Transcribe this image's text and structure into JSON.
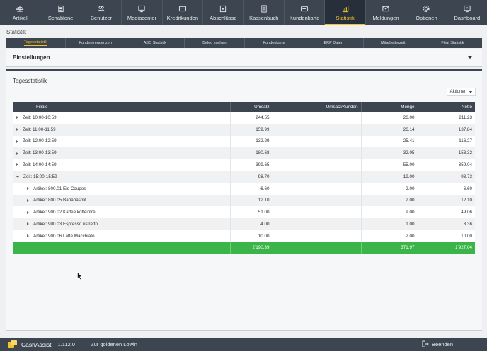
{
  "nav": [
    {
      "label": "Artikel",
      "icon": "scale-icon"
    },
    {
      "label": "Schablone",
      "icon": "template-icon"
    },
    {
      "label": "Benutzer",
      "icon": "users-icon"
    },
    {
      "label": "Mediacenter",
      "icon": "monitor-icon"
    },
    {
      "label": "Kreditkunden",
      "icon": "credit-card-icon"
    },
    {
      "label": "Abschlüsse",
      "icon": "closing-icon"
    },
    {
      "label": "Kassenbuch",
      "icon": "book-icon"
    },
    {
      "label": "Kundenkarte",
      "icon": "card-icon"
    },
    {
      "label": "Statistik",
      "icon": "chart-icon",
      "active": true
    },
    {
      "label": "Meldungen",
      "icon": "mail-icon"
    },
    {
      "label": "Optionen",
      "icon": "gear-icon"
    },
    {
      "label": "Dashboard",
      "icon": "dashboard-icon"
    }
  ],
  "page_title": "Statistik",
  "subtabs": [
    "Tagesstatistik",
    "Kundenfrequenzen",
    "ABC Statistik",
    "Beleg suchen",
    "Kundenkarte",
    "ERP Daten",
    "Mitarbeiterzeit",
    "Filial Statistik"
  ],
  "settings_title": "Einstellungen",
  "main_title": "Tagesstatistik",
  "actions_label": "Aktionen",
  "table": {
    "headers": [
      "Filiale",
      "Umsatz",
      "Umsatz/Kunden",
      "Menge",
      "Netto"
    ],
    "rows": [
      {
        "level": 0,
        "open": false,
        "name": "Zeit: 10:00-10:59",
        "umsatz": "244.55",
        "uk": "",
        "menge": "26.00",
        "netto": "211.23"
      },
      {
        "level": 0,
        "open": false,
        "name": "Zeit: 11:00-11:59",
        "umsatz": "159.99",
        "uk": "",
        "menge": "26.14",
        "netto": "137.84"
      },
      {
        "level": 0,
        "open": false,
        "name": "Zeit: 12:00-12:59",
        "umsatz": "132.29",
        "uk": "",
        "menge": "25.41",
        "netto": "116.27"
      },
      {
        "level": 0,
        "open": false,
        "name": "Zeit: 13:00-13:59",
        "umsatz": "180.68",
        "uk": "",
        "menge": "32.05",
        "netto": "153.32"
      },
      {
        "level": 0,
        "open": false,
        "name": "Zeit: 14:00-14:59",
        "umsatz": "399.65",
        "uk": "",
        "menge": "55.00",
        "netto": "359.04"
      },
      {
        "level": 0,
        "open": true,
        "name": "Zeit: 15:00-15:59",
        "umsatz": "98.70",
        "uk": "",
        "menge": "19.00",
        "netto": "93.73"
      },
      {
        "level": 1,
        "open": false,
        "name": "Artikel: 800.01 Eis-Coupes",
        "umsatz": "6.60",
        "uk": "",
        "menge": "2.00",
        "netto": "6.60"
      },
      {
        "level": 1,
        "open": false,
        "name": "Artikel: 800.05 Bananasplit",
        "umsatz": "12.10",
        "uk": "",
        "menge": "2.00",
        "netto": "12.10"
      },
      {
        "level": 1,
        "open": false,
        "name": "Artikel: 900.02 Kaffee koffeinfrei",
        "umsatz": "51.00",
        "uk": "",
        "menge": "9.00",
        "netto": "49.06"
      },
      {
        "level": 1,
        "open": false,
        "name": "Artikel: 900.03 Espresso ristretto",
        "umsatz": "4.00",
        "uk": "",
        "menge": "1.00",
        "netto": "3.36"
      },
      {
        "level": 1,
        "open": false,
        "name": "Artikel: 900.06 Latte Macchiato",
        "umsatz": "10.00",
        "uk": "",
        "menge": "2.00",
        "netto": "10.00"
      }
    ],
    "total": {
      "umsatz": "2'190.39",
      "uk": "",
      "menge": "371.97",
      "netto": "1'927.04"
    }
  },
  "footer": {
    "brand": "CashAssist",
    "version": "1.112.0",
    "store": "Zur goldenen Löwin",
    "logout_label": "Beenden"
  },
  "colors": {
    "nav_bg": "#3c4550",
    "accent": "#f2c230",
    "total_row": "#3bb54a"
  }
}
